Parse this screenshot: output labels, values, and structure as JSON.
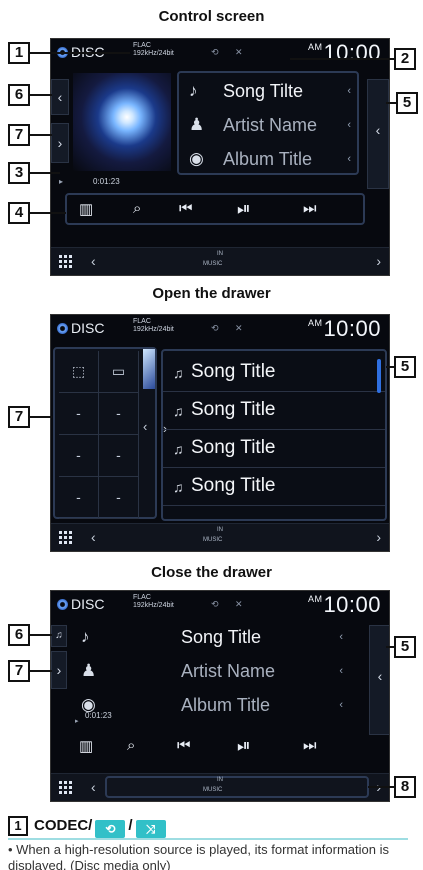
{
  "headings": {
    "control": "Control screen",
    "open": "Open the drawer",
    "close": "Close the drawer"
  },
  "status": {
    "source": "DISC",
    "codec_line1": "FLAC",
    "codec_line2": "192kHz/24bit",
    "ampm": "AM",
    "time": "10:00",
    "time_cropped": "10:00"
  },
  "track": {
    "song_control": "Song Tilte",
    "song_close": "Song Title",
    "artist": "Artist Name",
    "album": "Album Title",
    "elapsed": "0:01:23"
  },
  "drawer": {
    "list": [
      "Song Title",
      "Song Title",
      "Song Title",
      "Song Title"
    ],
    "dashes": [
      "-",
      "-",
      "-",
      "-",
      "-",
      "-"
    ]
  },
  "bottom_bar": {
    "music": "MUSIC",
    "in": "IN"
  },
  "callouts": [
    "1",
    "2",
    "3",
    "4",
    "5",
    "6",
    "7",
    "8"
  ],
  "section": {
    "number": "1",
    "title_codec": "CODEC/",
    "slash": "/",
    "bullet": "• When a high-resolution source is played, its format information is displayed. (Disc media only)"
  },
  "colors": {
    "accent": "#31c0c8",
    "screen_bg": "#07090f",
    "box_border": "#2c3a55"
  },
  "icons": {
    "repeat": "repeat-icon",
    "shuffle": "shuffle-icon",
    "eq": "equalizer-icon",
    "search": "search-icon",
    "prev": "previous-track-icon",
    "playpause": "play-pause-icon",
    "next": "next-track-icon",
    "menu": "menu-grid-icon"
  }
}
